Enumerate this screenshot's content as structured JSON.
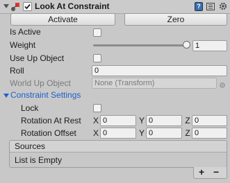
{
  "component": {
    "title": "Look At Constraint",
    "enabled": true
  },
  "buttons": {
    "activate": "Activate",
    "zero": "Zero"
  },
  "properties": {
    "is_active": {
      "label": "Is Active",
      "checked": false
    },
    "weight": {
      "label": "Weight",
      "value": "1",
      "slider_fraction": 1.0
    },
    "use_up_object": {
      "label": "Use Up Object",
      "checked": false
    },
    "roll": {
      "label": "Roll",
      "value": "0"
    },
    "world_up_object": {
      "label": "World Up Object",
      "value": "None (Transform)"
    }
  },
  "constraint_settings": {
    "label": "Constraint Settings",
    "expanded": true,
    "lock": {
      "label": "Lock",
      "checked": false
    },
    "rotation_at_rest": {
      "label": "Rotation At Rest",
      "x": "0",
      "y": "0",
      "z": "0"
    },
    "rotation_offset": {
      "label": "Rotation Offset",
      "x": "0",
      "y": "0",
      "z": "0"
    },
    "axis_labels": {
      "x": "X",
      "y": "Y",
      "z": "Z"
    }
  },
  "sources": {
    "header": "Sources",
    "empty_text": "List is Empty",
    "add_label": "+",
    "remove_label": "−"
  },
  "colors": {
    "panel_bg": "#c8c8c8",
    "section_link": "#1e5fcc",
    "component_icon": "#d9382b"
  },
  "icons": {
    "foldout": "triangle-down-icon",
    "component": "constraint-icon",
    "help": "help-icon",
    "settings": "gear-icon",
    "target": "target-circle-icon"
  }
}
